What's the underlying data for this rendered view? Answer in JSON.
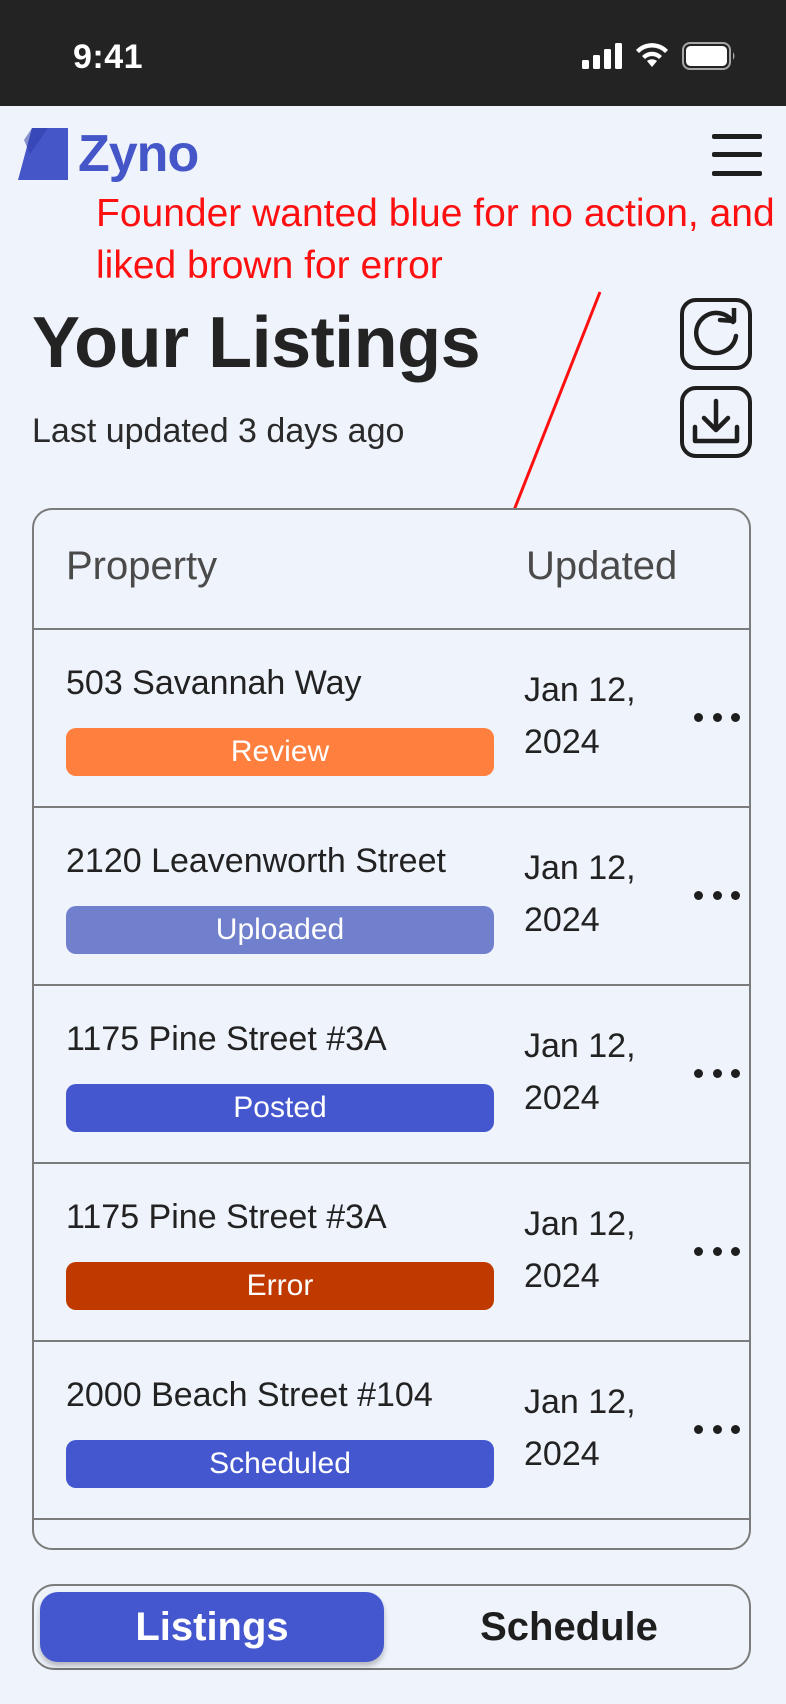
{
  "status_bar": {
    "time": "9:41"
  },
  "brand": {
    "name": "Zyno",
    "color": "#4556c9"
  },
  "annotation": {
    "text": "Founder wanted blue for no action, and liked brown for error",
    "color": "#ff1010"
  },
  "header": {
    "title": "Your Listings",
    "subtitle": "Last updated 3 days ago"
  },
  "table": {
    "columns": [
      "Property",
      "Updated"
    ],
    "rows": [
      {
        "address": "503 Savannah Way",
        "status": "Review",
        "status_color": "#ff7f3f",
        "date": "Jan 12, 2024"
      },
      {
        "address": "2120 Leavenworth Street",
        "status": "Uploaded",
        "status_color": "#7180cc",
        "date": "Jan 12, 2024"
      },
      {
        "address": "1175 Pine Street #3A",
        "status": "Posted",
        "status_color": "#4457cf",
        "date": "Jan 12, 2024"
      },
      {
        "address": "1175 Pine Street #3A",
        "status": "Error",
        "status_color": "#c03a00",
        "date": "Jan 12, 2024"
      },
      {
        "address": "2000 Beach Street #104",
        "status": "Scheduled",
        "status_color": "#4457cf",
        "date": "Jan 12, 2024"
      }
    ]
  },
  "tabs": {
    "listings": "Listings",
    "schedule": "Schedule",
    "active_color": "#4457cf"
  },
  "icons": [
    "menu-icon",
    "refresh-icon",
    "download-icon",
    "more-horizontal-icon",
    "signal-icon",
    "wifi-icon",
    "battery-icon"
  ]
}
